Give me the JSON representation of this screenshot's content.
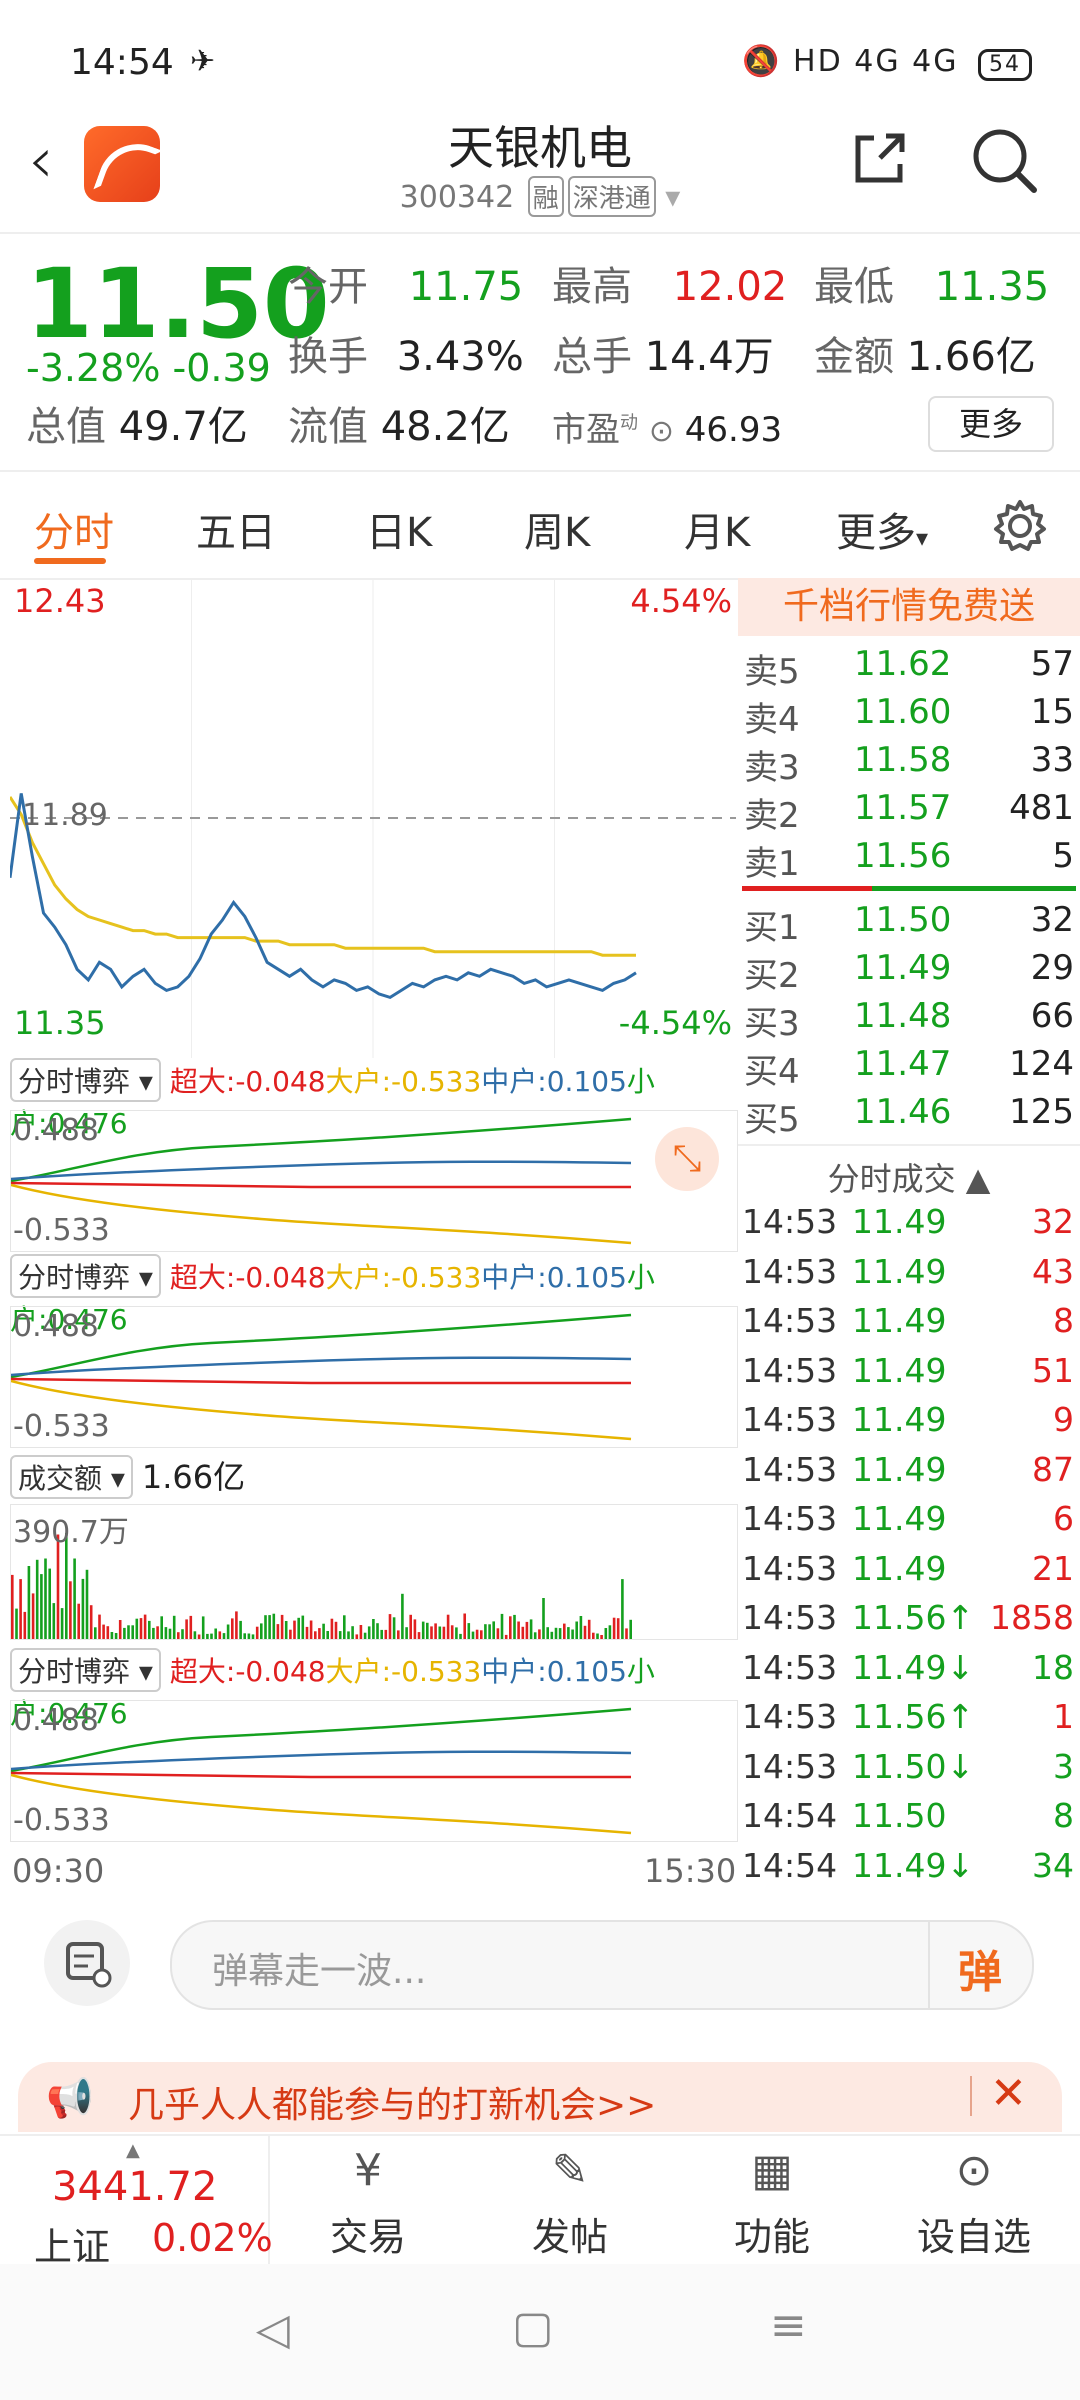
{
  "status": {
    "time": "14:54",
    "network": "HD 4G 4G",
    "battery": "54"
  },
  "header": {
    "name": "天银机电",
    "code": "300342",
    "tags": [
      "融",
      "深港通"
    ]
  },
  "quote": {
    "price": "11.50",
    "change_pct": "-3.28%",
    "change": "-0.39",
    "open_label": "今开",
    "open": "11.75",
    "high_label": "最高",
    "high": "12.02",
    "low_label": "最低",
    "low": "11.35",
    "turnover_label": "换手",
    "turnover": "3.43%",
    "volume_label": "总手",
    "volume": "14.4万",
    "amount_label": "金额",
    "amount": "1.66亿",
    "mktcap_label": "总值",
    "mktcap": "49.7亿",
    "float_label": "流值",
    "float": "48.2亿",
    "pe_label": "市盈",
    "pe_sup": "动",
    "pe": "46.93",
    "more": "更多"
  },
  "tabs": [
    "分时",
    "五日",
    "日K",
    "周K",
    "月K",
    "更多"
  ],
  "chart": {
    "ymax": "12.43",
    "ymin": "11.35",
    "pct_max": "4.54%",
    "pct_min": "-4.54%",
    "ref": "11.89",
    "time_start": "09:30",
    "time_end": "15:30",
    "price_series": [
      11.72,
      11.96,
      11.78,
      11.62,
      11.58,
      11.53,
      11.46,
      11.43,
      11.48,
      11.46,
      11.41,
      11.44,
      11.46,
      11.42,
      11.4,
      11.41,
      11.44,
      11.49,
      11.56,
      11.6,
      11.65,
      11.61,
      11.55,
      11.48,
      11.46,
      11.44,
      11.46,
      11.43,
      11.41,
      11.43,
      11.42,
      11.4,
      11.41,
      11.39,
      11.38,
      11.4,
      11.42,
      11.41,
      11.43,
      11.44,
      11.43,
      11.45,
      11.44,
      11.46,
      11.45,
      11.44,
      11.42,
      11.43,
      11.41,
      11.42,
      11.43,
      11.42,
      11.41,
      11.4,
      11.42,
      11.43,
      11.45
    ],
    "avg_series": [
      11.95,
      11.9,
      11.82,
      11.76,
      11.7,
      11.66,
      11.63,
      11.61,
      11.6,
      11.59,
      11.58,
      11.57,
      11.57,
      11.56,
      11.56,
      11.55,
      11.55,
      11.55,
      11.55,
      11.55,
      11.55,
      11.55,
      11.54,
      11.54,
      11.54,
      11.53,
      11.53,
      11.53,
      11.53,
      11.53,
      11.52,
      11.52,
      11.52,
      11.52,
      11.52,
      11.52,
      11.52,
      11.52,
      11.51,
      11.51,
      11.51,
      11.51,
      11.51,
      11.51,
      11.51,
      11.51,
      11.51,
      11.51,
      11.51,
      11.51,
      11.51,
      11.51,
      11.51,
      11.5,
      11.5,
      11.5,
      11.5
    ]
  },
  "flow": {
    "selector": "分时博弈",
    "super_label": "超大:",
    "super": "-0.048",
    "big_label": "大户:",
    "big": "-0.533",
    "mid_label": "中户:",
    "mid": "0.105",
    "small_label": "小户:",
    "small": "0.476",
    "ymax": "0.488",
    "ymin": "-0.533"
  },
  "volume_panel": {
    "selector": "成交额",
    "value": "1.66亿",
    "ymax": "390.7万"
  },
  "book": {
    "promo": "千档行情免费送",
    "asks": [
      {
        "label": "卖5",
        "price": "11.62",
        "vol": "57"
      },
      {
        "label": "卖4",
        "price": "11.60",
        "vol": "15"
      },
      {
        "label": "卖3",
        "price": "11.58",
        "vol": "33"
      },
      {
        "label": "卖2",
        "price": "11.57",
        "vol": "481"
      },
      {
        "label": "卖1",
        "price": "11.56",
        "vol": "5"
      }
    ],
    "bids": [
      {
        "label": "买1",
        "price": "11.50",
        "vol": "32"
      },
      {
        "label": "买2",
        "price": "11.49",
        "vol": "29"
      },
      {
        "label": "买3",
        "price": "11.48",
        "vol": "66"
      },
      {
        "label": "买4",
        "price": "11.47",
        "vol": "124"
      },
      {
        "label": "买5",
        "price": "11.46",
        "vol": "125"
      }
    ],
    "trades_title": "分时成交",
    "trades": [
      {
        "t": "14:53",
        "p": "11.49",
        "v": "32",
        "vc": "red"
      },
      {
        "t": "14:53",
        "p": "11.49",
        "v": "43",
        "vc": "red"
      },
      {
        "t": "14:53",
        "p": "11.49",
        "v": "8",
        "vc": "red"
      },
      {
        "t": "14:53",
        "p": "11.49",
        "v": "51",
        "vc": "red"
      },
      {
        "t": "14:53",
        "p": "11.49",
        "v": "9",
        "vc": "red"
      },
      {
        "t": "14:53",
        "p": "11.49",
        "v": "87",
        "vc": "red"
      },
      {
        "t": "14:53",
        "p": "11.49",
        "v": "6",
        "vc": "red"
      },
      {
        "t": "14:53",
        "p": "11.49",
        "v": "21",
        "vc": "red"
      },
      {
        "t": "14:53",
        "p": "11.56↑",
        "v": "1858",
        "vc": "red"
      },
      {
        "t": "14:53",
        "p": "11.49↓",
        "v": "18",
        "vc": "green"
      },
      {
        "t": "14:53",
        "p": "11.56↑",
        "v": "1",
        "vc": "red"
      },
      {
        "t": "14:53",
        "p": "11.50↓",
        "v": "3",
        "vc": "green"
      },
      {
        "t": "14:54",
        "p": "11.50",
        "v": "8",
        "vc": "green"
      },
      {
        "t": "14:54",
        "p": "11.49↓",
        "v": "34",
        "vc": "green"
      }
    ]
  },
  "comment": {
    "placeholder": "弹幕走一波...",
    "danmu": "弹"
  },
  "banner": {
    "text": "几乎人人都能参与的打新机会>>"
  },
  "bottom": {
    "index_value": "3441.72",
    "index_name": "上证",
    "index_change": "0.02%",
    "items": [
      "交易",
      "发帖",
      "功能",
      "设自选"
    ]
  },
  "colors": {
    "up": "#e02020",
    "down": "#14a01e",
    "accent": "#f06a1e",
    "price_line": "#2f6ea8",
    "avg_line": "#e6c21e"
  }
}
